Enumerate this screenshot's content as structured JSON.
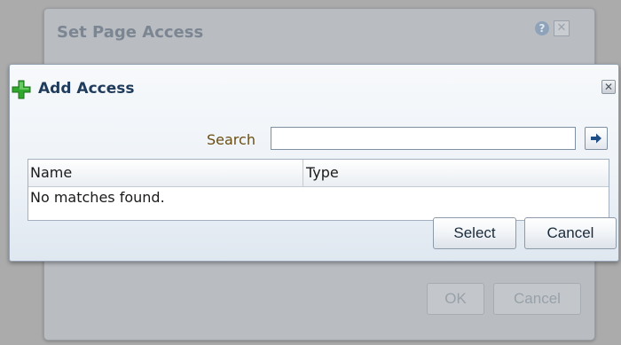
{
  "background_dialog": {
    "title": "Set Page Access",
    "help_icon": "help-icon",
    "close_icon": "close-icon",
    "ok_label": "OK",
    "cancel_label": "Cancel"
  },
  "dialog": {
    "title": "Add Access",
    "title_icon": "plus-icon",
    "close_icon": "close-icon",
    "search": {
      "label": "Search",
      "value": "",
      "placeholder": "",
      "go_icon": "arrow-right-icon"
    },
    "table": {
      "columns": [
        "Name",
        "Type"
      ],
      "empty_message": "No matches found."
    },
    "select_label": "Select",
    "cancel_label": "Cancel"
  },
  "colors": {
    "accent_green": "#2fa82b",
    "title_blue": "#1f3b5c",
    "search_label": "#6b4e12",
    "arrow_blue": "#1e4d86"
  }
}
